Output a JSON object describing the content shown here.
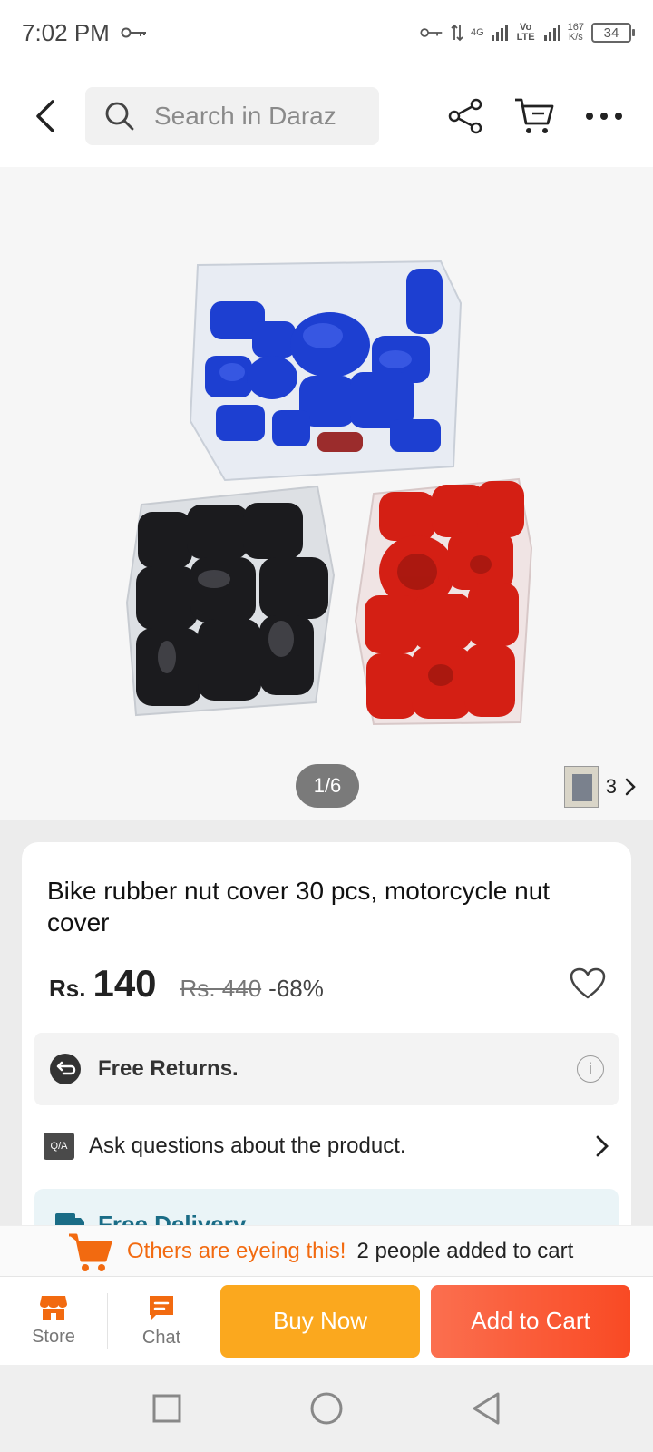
{
  "status_bar": {
    "time": "7:02 PM",
    "network_type": "4G",
    "volte": "Vo LTE",
    "speed_value": "167",
    "speed_unit": "K/s",
    "battery": "34"
  },
  "top_nav": {
    "search_placeholder": "Search in Daraz"
  },
  "gallery": {
    "page_indicator": "1/6",
    "thumb_count": "3"
  },
  "product": {
    "title": "Bike rubber nut cover 30 pcs, motorcycle nut cover",
    "currency": "Rs.",
    "price": "140",
    "original_price": "Rs. 440",
    "discount": "-68%",
    "returns_label": "Free Returns.",
    "info_label": "i",
    "qa_badge": "Q/A",
    "qa_label": "Ask questions about the product.",
    "delivery_text": "Free Delivery"
  },
  "banner": {
    "highlight": "Others are eyeing this!",
    "rest": "2 people added to cart"
  },
  "action_bar": {
    "store_label": "Store",
    "chat_label": "Chat",
    "buy_label": "Buy Now",
    "cart_label": "Add to Cart"
  },
  "colors": {
    "accent_orange": "#f26a10",
    "buy_now": "#fba81e",
    "add_to_cart": "#f94a24",
    "delivery_teal": "#1a6c86"
  }
}
